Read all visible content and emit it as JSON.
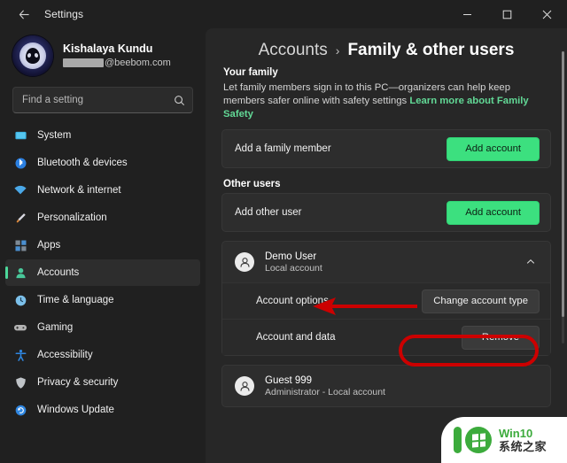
{
  "window": {
    "title": "Settings",
    "back_icon": "back-arrow-icon",
    "minimize_label": "Minimize",
    "maximize_label": "Maximize",
    "close_label": "Close"
  },
  "account": {
    "name": "Kishalaya Kundu",
    "email_domain": "@beebom.com",
    "avatar_icon": "alien-avatar-icon"
  },
  "search": {
    "placeholder": "Find a setting",
    "value": "",
    "icon": "search-icon"
  },
  "sidebar": {
    "items": [
      {
        "label": "System",
        "icon": "monitor-icon",
        "color": "#3ab0e0",
        "selected": false
      },
      {
        "label": "Bluetooth & devices",
        "icon": "bluetooth-icon",
        "color": "#2b7fe0",
        "selected": false
      },
      {
        "label": "Network & internet",
        "icon": "wifi-icon",
        "color": "#4aa8e8",
        "selected": false
      },
      {
        "label": "Personalization",
        "icon": "paintbrush-icon",
        "color": "#d8a45a",
        "selected": false
      },
      {
        "label": "Apps",
        "icon": "apps-icon",
        "color": "#4a8fd0",
        "selected": false
      },
      {
        "label": "Accounts",
        "icon": "person-icon",
        "color": "#49c79a",
        "selected": true
      },
      {
        "label": "Time & language",
        "icon": "clock-icon",
        "color": "#7cc0ea",
        "selected": false
      },
      {
        "label": "Gaming",
        "icon": "gamepad-icon",
        "color": "#b4b4b4",
        "selected": false
      },
      {
        "label": "Accessibility",
        "icon": "accessibility-icon",
        "color": "#2f86e0",
        "selected": false
      },
      {
        "label": "Privacy & security",
        "icon": "shield-icon",
        "color": "#c0c4c8",
        "selected": false
      },
      {
        "label": "Windows Update",
        "icon": "update-icon",
        "color": "#2f86e0",
        "selected": false
      }
    ],
    "accent_color": "#4cd79a"
  },
  "breadcrumb": {
    "root": "Accounts",
    "separator": "›",
    "leaf": "Family & other users"
  },
  "family": {
    "section_title": "Your family",
    "description": "Let family members sign in to this PC—organizers can help keep members safer online with safety settings ",
    "link_text": "Learn more about Family Safety",
    "link_color": "#62d996",
    "add_member_label": "Add a family member",
    "add_account_button": "Add account"
  },
  "other_users": {
    "section_title": "Other users",
    "add_user_label": "Add other user",
    "add_account_button": "Add account",
    "users": [
      {
        "name": "Demo User",
        "subtitle": "Local account",
        "icon": "user-avatar-icon",
        "expanded": true,
        "chevron_icon": "chevron-up-icon",
        "options": [
          {
            "label": "Account options",
            "button": "Change account type",
            "highlighted": true
          },
          {
            "label": "Account and data",
            "button": "Remove",
            "highlighted": false
          }
        ]
      },
      {
        "name": "Guest 999",
        "subtitle": "Administrator - Local account",
        "icon": "user-avatar-icon",
        "expanded": false,
        "chevron_icon": "chevron-down-icon",
        "options": []
      }
    ]
  },
  "annotations": {
    "arrow_color": "#cc0000",
    "highlight_color": "#cc0000",
    "arrow_target": "Demo User",
    "highlight_target": "Change account type"
  },
  "watermark": {
    "brand_en": "Win10",
    "brand_cn": "系统之家",
    "logo_icon": "win10-home-logo-icon",
    "green": "#3cab3c"
  },
  "button_colors": {
    "green_accent": "#3ce07f",
    "gray_button": "#3a3a3a"
  }
}
